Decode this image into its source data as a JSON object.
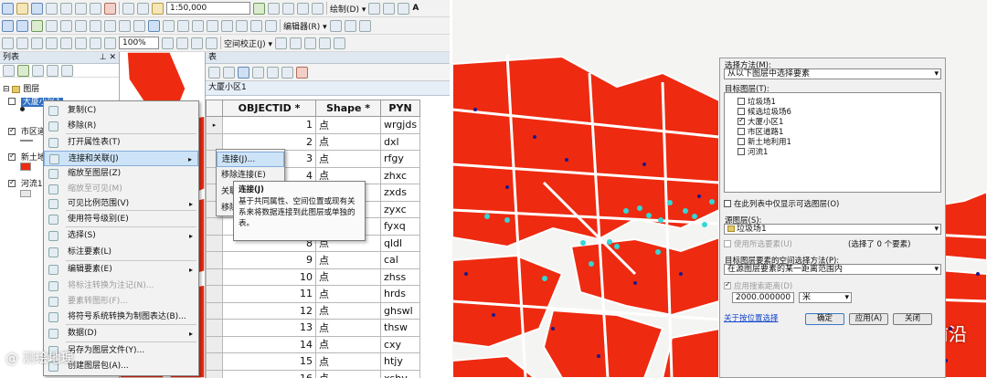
{
  "toolbar": {
    "scale": "1:50,000",
    "draw_label": "绘制(D) ▾",
    "text_tool_label": "A",
    "zoom_level": "100%",
    "spatial_adjust_label": "空间校正(J) ▾",
    "editor_label": "编辑器(R) ▾"
  },
  "toc": {
    "title": "列表",
    "layers_root": "图层",
    "layer_selected": "大厦小区1",
    "layer_road": "市区道",
    "layer_land": "新土地",
    "layer_river": "河流1"
  },
  "context_menu": {
    "items": [
      {
        "label": "复制(C)",
        "state": "normal"
      },
      {
        "label": "移除(R)",
        "state": "normal"
      },
      {
        "label": "打开属性表(T)",
        "state": "normal"
      },
      {
        "label": "连接和关联(J)",
        "state": "highlight",
        "arrow": "▸"
      },
      {
        "label": "缩放至图层(Z)",
        "state": "normal"
      },
      {
        "label": "缩放至可见(M)",
        "state": "disabled"
      },
      {
        "label": "可见比例范围(V)",
        "state": "normal",
        "arrow": "▸"
      },
      {
        "label": "使用符号级别(E)",
        "state": "normal"
      },
      {
        "label": "选择(S)",
        "state": "normal",
        "arrow": "▸"
      },
      {
        "label": "标注要素(L)",
        "state": "normal"
      },
      {
        "label": "编辑要素(E)",
        "state": "normal",
        "arrow": "▸"
      },
      {
        "label": "将标注转换为注记(N)...",
        "state": "disabled"
      },
      {
        "label": "要素转图形(F)...",
        "state": "disabled"
      },
      {
        "label": "将符号系统转换为制图表达(B)...",
        "state": "normal"
      },
      {
        "label": "数据(D)",
        "state": "normal",
        "arrow": "▸"
      },
      {
        "label": "另存为图层文件(Y)...",
        "state": "normal"
      },
      {
        "label": "创建图层包(A)...",
        "state": "normal"
      }
    ]
  },
  "submenu": {
    "items": [
      "连接(J)...",
      "移除连接(E)",
      "关联(R)...",
      "移除关联(M)"
    ]
  },
  "tooltip": {
    "title": "连接(J)",
    "body": "基于共同属性、空间位置或现有关系来将数据连接到此图层或单独的表。"
  },
  "attribute_table": {
    "window_title": "表",
    "layer_tab": "大厦小区1",
    "columns": [
      "OBJECTID *",
      "Shape *",
      "PYN"
    ],
    "rows": [
      [
        "1",
        "点",
        "wrgjds"
      ],
      [
        "2",
        "点",
        "dxl"
      ],
      [
        "3",
        "点",
        "rfgy"
      ],
      [
        "4",
        "点",
        "zhxc"
      ],
      [
        "5",
        "点",
        "zxds"
      ],
      [
        "6",
        "点",
        "zyxc"
      ],
      [
        "7",
        "点",
        "fyxq"
      ],
      [
        "8",
        "点",
        "qldl"
      ],
      [
        "9",
        "点",
        "cal"
      ],
      [
        "10",
        "点",
        "zhss"
      ],
      [
        "11",
        "点",
        "hrds"
      ],
      [
        "12",
        "点",
        "ghswl"
      ],
      [
        "13",
        "点",
        "thsw"
      ],
      [
        "14",
        "点",
        "cxy"
      ],
      [
        "15",
        "点",
        "htjy"
      ],
      [
        "16",
        "点",
        "xshy"
      ]
    ]
  },
  "dialog": {
    "method_label": "选择方法(M):",
    "method_value": "从以下图层中选择要素",
    "target_layers_label": "目标图层(T):",
    "target_layers": [
      {
        "label": "垃圾场1",
        "checked": false
      },
      {
        "label": "候选垃圾场6",
        "checked": false
      },
      {
        "label": "大厦小区1",
        "checked": true
      },
      {
        "label": "市区道路1",
        "checked": false
      },
      {
        "label": "新土地利用1",
        "checked": false
      },
      {
        "label": "河流1",
        "checked": false
      }
    ],
    "only_selectable_label": "在此列表中仅显示可选图层(O)",
    "source_layer_label": "源图层(S):",
    "source_layer_value": "垃圾场1",
    "use_selected_label": "使用所选要素(U)",
    "selected_count": "(选择了 0 个要素)",
    "spatial_method_label": "目标图层要素的空间选择方法(P):",
    "spatial_method_value": "在源图层要素的某一距离范围内",
    "apply_distance_label": "应用搜索距离(D)",
    "distance_value": "2000.000000",
    "distance_unit": "米",
    "help_link": "关于按位置选择",
    "ok_label": "确定",
    "apply_label": "应用(A)",
    "close_label": "关闭"
  },
  "watermark": {
    "right": "GIS前沿",
    "left": "@ 测绘地理"
  },
  "colors": {
    "polygon_fill": "#ee2a10",
    "road": "#ffffff",
    "highlight": "#cde3f7",
    "poi_dark": "#1a1a8c",
    "poi_cyan": "#33d7d7"
  }
}
